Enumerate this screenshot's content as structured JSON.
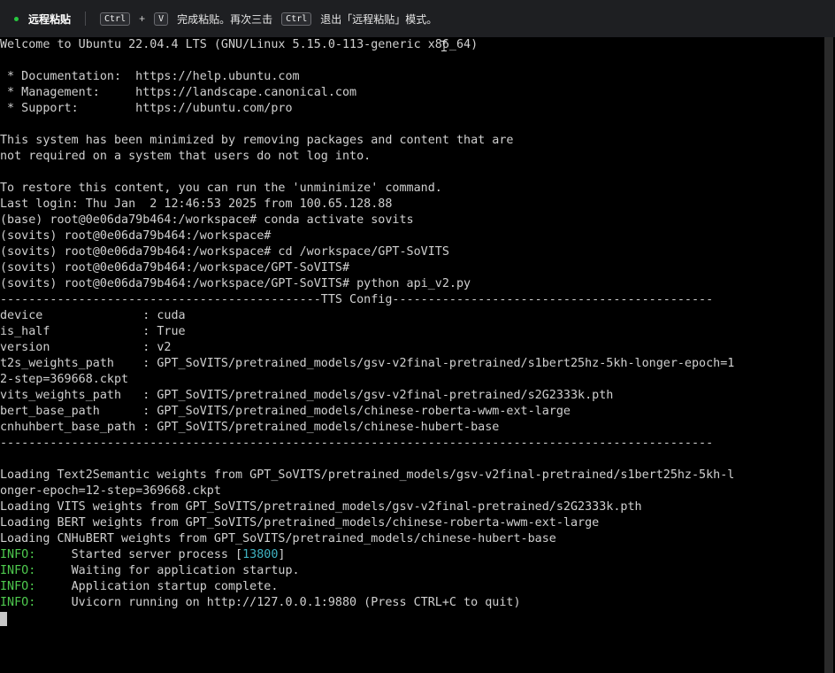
{
  "banner": {
    "title": "远程粘贴",
    "key_ctrl": "Ctrl",
    "plus": "+",
    "key_v": "V",
    "text1": "完成粘贴。再次三击",
    "key_ctrl2": "Ctrl",
    "text2": "退出「远程粘贴」模式。",
    "status_color": "#27c93f"
  },
  "terminal": {
    "lines": [
      "Welcome to Ubuntu 22.04.4 LTS (GNU/Linux 5.15.0-113-generic x86_64)",
      "",
      " * Documentation:  https://help.ubuntu.com",
      " * Management:     https://landscape.canonical.com",
      " * Support:        https://ubuntu.com/pro",
      "",
      "This system has been minimized by removing packages and content that are",
      "not required on a system that users do not log into.",
      "",
      "To restore this content, you can run the 'unminimize' command.",
      "Last login: Thu Jan  2 12:46:53 2025 from 100.65.128.88",
      "(base) root@0e06da79b464:/workspace# conda activate sovits",
      "(sovits) root@0e06da79b464:/workspace#",
      "(sovits) root@0e06da79b464:/workspace# cd /workspace/GPT-SoVITS",
      "(sovits) root@0e06da79b464:/workspace/GPT-SoVITS#",
      "(sovits) root@0e06da79b464:/workspace/GPT-SoVITS# python api_v2.py",
      "---------------------------------------------TTS Config---------------------------------------------",
      "device              : cuda",
      "is_half             : True",
      "version             : v2",
      "t2s_weights_path    : GPT_SoVITS/pretrained_models/gsv-v2final-pretrained/s1bert25hz-5kh-longer-epoch=1",
      "2-step=369668.ckpt",
      "vits_weights_path   : GPT_SoVITS/pretrained_models/gsv-v2final-pretrained/s2G2333k.pth",
      "bert_base_path      : GPT_SoVITS/pretrained_models/chinese-roberta-wwm-ext-large",
      "cnhuhbert_base_path : GPT_SoVITS/pretrained_models/chinese-hubert-base",
      "----------------------------------------------------------------------------------------------------",
      "",
      "Loading Text2Semantic weights from GPT_SoVITS/pretrained_models/gsv-v2final-pretrained/s1bert25hz-5kh-l",
      "onger-epoch=12-step=369668.ckpt",
      "Loading VITS weights from GPT_SoVITS/pretrained_models/gsv-v2final-pretrained/s2G2333k.pth",
      "Loading BERT weights from GPT_SoVITS/pretrained_models/chinese-roberta-wwm-ext-large",
      "Loading CNHuBERT weights from GPT_SoVITS/pretrained_models/chinese-hubert-base"
    ],
    "info_lines": [
      {
        "level": "INFO:",
        "pad": "     ",
        "pre": "Started server process [",
        "pid": "13800",
        "post": "]"
      },
      {
        "level": "INFO:",
        "pad": "     ",
        "pre": "Waiting for application startup.",
        "pid": "",
        "post": ""
      },
      {
        "level": "INFO:",
        "pad": "     ",
        "pre": "Application startup complete.",
        "pid": "",
        "post": ""
      },
      {
        "level": "INFO:",
        "pad": "     ",
        "pre": "Uvicorn running on http://127.0.0.1:9880 (Press CTRL+C to quit)",
        "pid": "",
        "post": ""
      }
    ],
    "colors": {
      "text": "#d0d0d0",
      "info": "#4ec94e",
      "pid": "#3fb2c2",
      "background": "#000000"
    }
  }
}
